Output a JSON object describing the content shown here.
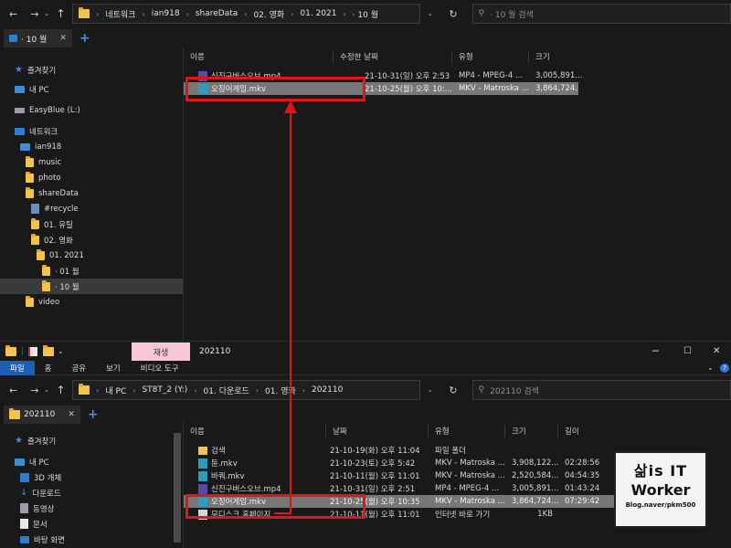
{
  "top": {
    "address": [
      "네트워크",
      "ian918",
      "shareData",
      "02. 영화",
      "01. 2021",
      "· 10 월"
    ],
    "search_placeholder": "· 10 월 검색",
    "tab_label": "· 10 월",
    "nav": [
      {
        "label": "즐겨찾기",
        "icon": "star-icon"
      },
      {
        "label": "내 PC",
        "icon": "pc-icon"
      },
      {
        "label": "EasyBlue (L:)",
        "icon": "drive-icon"
      },
      {
        "label": "네트워크",
        "icon": "network-icon"
      },
      {
        "label": "ian918",
        "icon": "computer-icon"
      },
      {
        "label": "music",
        "icon": "folder-icon"
      },
      {
        "label": "photo",
        "icon": "folder-icon"
      },
      {
        "label": "shareData",
        "icon": "folder-icon"
      },
      {
        "label": "#recycle",
        "icon": "recycle-icon"
      },
      {
        "label": "01. 유틸",
        "icon": "folder-icon"
      },
      {
        "label": "02. 영화",
        "icon": "folder-icon"
      },
      {
        "label": "01. 2021",
        "icon": "folder-icon"
      },
      {
        "label": "· 01 월",
        "icon": "folder-icon"
      },
      {
        "label": "· 10 월",
        "icon": "folder-icon"
      },
      {
        "label": "video",
        "icon": "folder-icon"
      }
    ],
    "columns": [
      "이름",
      "수정한 날짜",
      "유형",
      "크기"
    ],
    "files": [
      {
        "name": "신진구버스오브.mp4",
        "date": "21-10-31(일) 오후 2:53",
        "type": "MP4 - MPEG-4 ...",
        "size": "3,005,891...",
        "kind": "mp4"
      },
      {
        "name": "오징어게임.mkv",
        "date": "21-10-25(월) 오후 10:...",
        "type": "MKV - Matroska ...",
        "size": "3,864,724...",
        "kind": "mkv"
      }
    ]
  },
  "bottom": {
    "context_tab": "재생",
    "window_title": "202110",
    "ribbon_tabs": [
      "파일",
      "홈",
      "공유",
      "보기",
      "비디오 도구"
    ],
    "address": [
      "내 PC",
      "ST8T_2 (Y:)",
      "01. 다운로드",
      "01. 영화",
      "202110"
    ],
    "search_placeholder": "202110 검색",
    "tab_label": "202110",
    "nav": [
      {
        "label": "즐겨찾기",
        "icon": "star-icon"
      },
      {
        "label": "내 PC",
        "icon": "pc-icon"
      },
      {
        "label": "3D 개체",
        "icon": "3d-objects-icon"
      },
      {
        "label": "다운로드",
        "icon": "download-icon"
      },
      {
        "label": "동영상",
        "icon": "video-icon"
      },
      {
        "label": "문서",
        "icon": "document-icon"
      },
      {
        "label": "바탕 화면",
        "icon": "desktop-icon"
      }
    ],
    "columns": [
      "이름",
      "날짜",
      "유형",
      "크기",
      "길이"
    ],
    "files": [
      {
        "name": "검색",
        "date": "21-10-19(화) 오후 11:04",
        "type": "파일 폴더",
        "size": "",
        "length": "",
        "kind": "folder"
      },
      {
        "name": "듄.mkv",
        "date": "21-10-23(토) 오후 5:42",
        "type": "MKV - Matroska ...",
        "size": "3,908,122...",
        "length": "02:28:56",
        "kind": "mkv"
      },
      {
        "name": "바쿼.mkv",
        "date": "21-10-11(월) 오후 11:01",
        "type": "MKV - Matroska ...",
        "size": "2,520,584...",
        "length": "04:54:35",
        "kind": "mkv"
      },
      {
        "name": "신진구버스오브.mp4",
        "date": "21-10-31(일) 오후 2:51",
        "type": "MP4 - MPEG-4 ...",
        "size": "3,005,891...",
        "length": "01:43:24",
        "kind": "mp4"
      },
      {
        "name": "오징어게임.mkv",
        "date": "21-10-25(월) 오후 10:35",
        "type": "MKV - Matroska ...",
        "size": "3,864,724...",
        "length": "07:29:42",
        "kind": "mkv"
      },
      {
        "name": "무디스크 홈페이지",
        "date": "21-10-11(월) 오후 11:01",
        "type": "인터넷 바로 가기",
        "size": "1KB",
        "length": "",
        "kind": "url"
      }
    ]
  },
  "badge": {
    "line1": "삶is IT",
    "line2": "Worker",
    "line3": "Blog.naver/pkm500"
  },
  "colors": {
    "annotation": "#e0151a",
    "selection": "#777777",
    "context_tab": "#f7c7d9",
    "file_tab": "#1d5fb3"
  }
}
